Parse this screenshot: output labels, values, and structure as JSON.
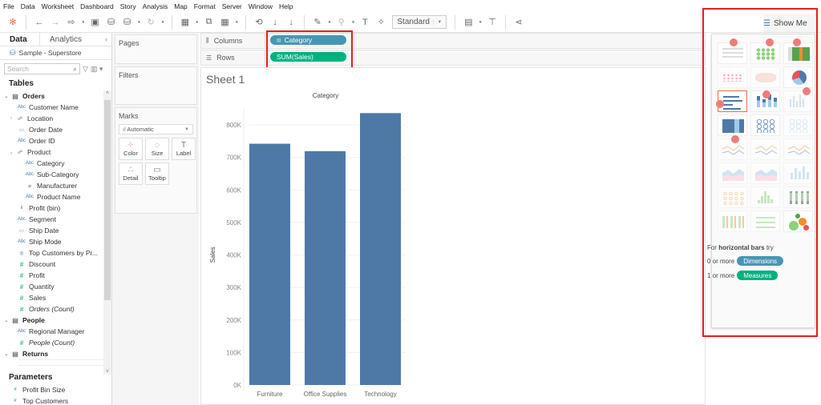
{
  "menu": [
    "File",
    "Data",
    "Worksheet",
    "Dashboard",
    "Story",
    "Analysis",
    "Map",
    "Format",
    "Server",
    "Window",
    "Help"
  ],
  "toolbar": {
    "fit_select": "Standard",
    "icons": [
      "tableau-logo-icon",
      "undo-icon",
      "redo-icon",
      "replay-icon",
      "save-icon",
      "new-datasource-icon",
      "pause-updates-icon",
      "refresh-icon",
      "new-worksheet-icon",
      "duplicate-icon",
      "clear-sheet-icon",
      "swap-icon",
      "sort-asc-icon",
      "sort-desc-icon",
      "highlight-icon",
      "group-icon",
      "labels-icon",
      "pin-icon",
      "show-cards-icon",
      "presentation-icon",
      "share-icon"
    ]
  },
  "data_pane": {
    "tabs": [
      "Data",
      "Analytics"
    ],
    "source": "Sample - Superstore",
    "search_placeholder": "Search",
    "tables_heading": "Tables",
    "fields": [
      {
        "label": "Orders",
        "kind": "table",
        "caret": "v"
      },
      {
        "label": "Customer Name",
        "kind": "dim",
        "icon": "Abc",
        "indent": 2
      },
      {
        "label": "Location",
        "kind": "dim",
        "icon": "hier",
        "indent": 1,
        "caret": ">"
      },
      {
        "label": "Order Date",
        "kind": "dim",
        "icon": "date",
        "indent": 2
      },
      {
        "label": "Order ID",
        "kind": "dim",
        "icon": "Abc",
        "indent": 2
      },
      {
        "label": "Product",
        "kind": "dim",
        "icon": "hier",
        "indent": 1,
        "caret": "v"
      },
      {
        "label": "Category",
        "kind": "dim",
        "icon": "Abc",
        "indent": 3
      },
      {
        "label": "Sub-Category",
        "kind": "dim",
        "icon": "Abc",
        "indent": 3
      },
      {
        "label": "Manufacturer",
        "kind": "dim",
        "icon": "clip",
        "indent": 3
      },
      {
        "label": "Product Name",
        "kind": "dim",
        "icon": "Abc",
        "indent": 3
      },
      {
        "label": "Profit (bin)",
        "kind": "dim",
        "icon": "bin",
        "indent": 2
      },
      {
        "label": "Segment",
        "kind": "dim",
        "icon": "Abc",
        "indent": 2
      },
      {
        "label": "Ship Date",
        "kind": "dim",
        "icon": "date",
        "indent": 2
      },
      {
        "label": "Ship Mode",
        "kind": "dim",
        "icon": "Abc",
        "indent": 2
      },
      {
        "label": "Top Customers by Pr...",
        "kind": "dim",
        "icon": "set",
        "indent": 2
      },
      {
        "label": "Discount",
        "kind": "meas",
        "icon": "#",
        "indent": 2,
        "sep": true
      },
      {
        "label": "Profit",
        "kind": "meas",
        "icon": "#",
        "indent": 2
      },
      {
        "label": "Quantity",
        "kind": "meas",
        "icon": "#",
        "indent": 2
      },
      {
        "label": "Sales",
        "kind": "meas",
        "icon": "#",
        "indent": 2
      },
      {
        "label": "Orders (Count)",
        "kind": "meas",
        "icon": "#",
        "indent": 2,
        "italic": true
      },
      {
        "label": "",
        "kind": "gap"
      },
      {
        "label": "People",
        "kind": "table",
        "caret": "v"
      },
      {
        "label": "Regional Manager",
        "kind": "dim",
        "icon": "Abc",
        "indent": 2
      },
      {
        "label": "People (Count)",
        "kind": "meas",
        "icon": "#",
        "indent": 2,
        "italic": true,
        "sep": true
      },
      {
        "label": "",
        "kind": "gap"
      },
      {
        "label": "Returns",
        "kind": "table",
        "caret": "v"
      }
    ],
    "parameters_heading": "Parameters",
    "parameters": [
      "Profit Bin Size",
      "Top Customers"
    ]
  },
  "cards": {
    "pages": "Pages",
    "filters": "Filters",
    "marks": "Marks",
    "mark_type": "Automatic",
    "mark_buttons": [
      {
        "label": "Color",
        "icon": "color-icon",
        "glyph": "⁘"
      },
      {
        "label": "Size",
        "icon": "size-icon",
        "glyph": "◌"
      },
      {
        "label": "Label",
        "icon": "label-icon",
        "glyph": "T"
      },
      {
        "label": "Detail",
        "icon": "detail-icon",
        "glyph": "∴"
      },
      {
        "label": "Tooltip",
        "icon": "tooltip-icon",
        "glyph": "▭"
      }
    ]
  },
  "shelves": {
    "columns_label": "Columns",
    "rows_label": "Rows",
    "columns_pill": "Category",
    "rows_pill": "SUM(Sales)"
  },
  "sheet": {
    "title": "Sheet 1"
  },
  "chart_data": {
    "type": "bar",
    "title": "Category",
    "xlabel": "",
    "ylabel": "Sales",
    "categories": [
      "Furniture",
      "Office Supplies",
      "Technology"
    ],
    "values": [
      741999.8,
      719047.0,
      836154.0
    ],
    "ylim": [
      0,
      850000
    ],
    "yticks": [
      0,
      100000,
      200000,
      300000,
      400000,
      500000,
      600000,
      700000,
      800000
    ],
    "ytick_labels": [
      "0K",
      "100K",
      "200K",
      "300K",
      "400K",
      "500K",
      "600K",
      "700K",
      "800K"
    ],
    "grid": true,
    "bar_color": "#4e79a7"
  },
  "show_me": {
    "tab_label": "Show Me",
    "charts": [
      {
        "name": "text-table",
        "enabled": true,
        "recommended": true
      },
      {
        "name": "heat-map",
        "enabled": true,
        "recommended": true
      },
      {
        "name": "highlight-table",
        "enabled": true,
        "recommended": true
      },
      {
        "name": "symbol-map",
        "enabled": false
      },
      {
        "name": "filled-map",
        "enabled": false
      },
      {
        "name": "pie-chart",
        "enabled": true,
        "recommended": true
      },
      {
        "name": "horizontal-bars",
        "enabled": true,
        "selected": true,
        "recommended": true
      },
      {
        "name": "stacked-bars",
        "enabled": true,
        "recommended": true
      },
      {
        "name": "side-by-side-bars",
        "enabled": false
      },
      {
        "name": "treemap",
        "enabled": true,
        "recommended": true
      },
      {
        "name": "circle-views",
        "enabled": true
      },
      {
        "name": "side-by-side-circles",
        "enabled": false
      },
      {
        "name": "lines-continuous",
        "enabled": false
      },
      {
        "name": "lines-discrete",
        "enabled": false
      },
      {
        "name": "dual-lines",
        "enabled": false
      },
      {
        "name": "area-continuous",
        "enabled": false
      },
      {
        "name": "area-discrete",
        "enabled": false
      },
      {
        "name": "dual-combination",
        "enabled": false
      },
      {
        "name": "scatter-plot",
        "enabled": false
      },
      {
        "name": "histogram",
        "enabled": false
      },
      {
        "name": "box-and-whisker",
        "enabled": false
      },
      {
        "name": "gantt-chart",
        "enabled": false
      },
      {
        "name": "bullet-graph",
        "enabled": false
      },
      {
        "name": "packed-bubbles",
        "enabled": true
      }
    ],
    "hint_prefix": "For ",
    "hint_bold": "horizontal bars",
    "hint_suffix": " try",
    "dims_prefix": "0 or more",
    "dims_label": "Dimensions",
    "meas_prefix": "1 or more",
    "meas_label": "Measures"
  },
  "colors": {
    "dimension": "#4996b2",
    "measure": "#00b180",
    "highlight": "#e41f1f",
    "recommend_dot": "#f17b7b"
  }
}
